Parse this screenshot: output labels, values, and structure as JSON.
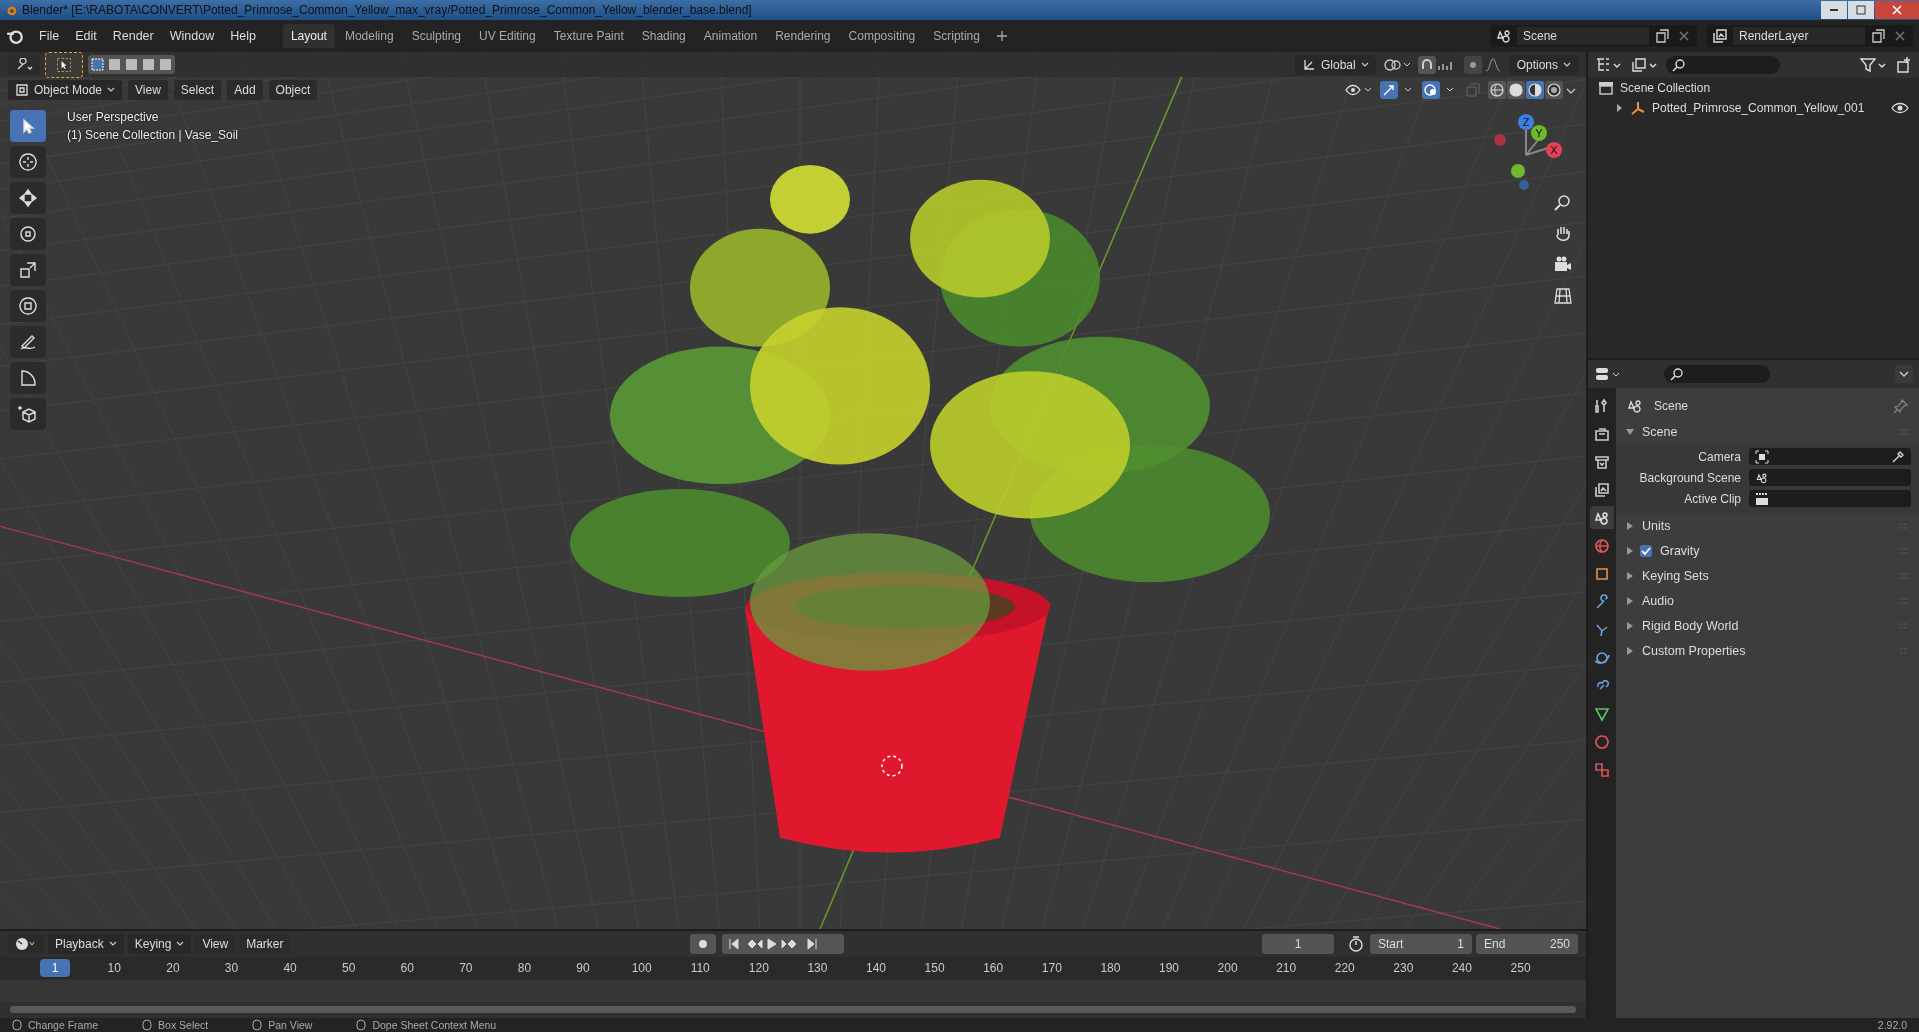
{
  "window": {
    "title": "Blender* [E:\\RABOTA\\CONVERT\\Potted_Primrose_Common_Yellow_max_vray/Potted_Primrose_Common_Yellow_blender_base.blend]"
  },
  "menu": [
    "File",
    "Edit",
    "Render",
    "Window",
    "Help"
  ],
  "workspaces": [
    {
      "label": "Layout",
      "selected": true
    },
    {
      "label": "Modeling",
      "selected": false
    },
    {
      "label": "Sculpting",
      "selected": false
    },
    {
      "label": "UV Editing",
      "selected": false
    },
    {
      "label": "Texture Paint",
      "selected": false
    },
    {
      "label": "Shading",
      "selected": false
    },
    {
      "label": "Animation",
      "selected": false
    },
    {
      "label": "Rendering",
      "selected": false
    },
    {
      "label": "Compositing",
      "selected": false
    },
    {
      "label": "Scripting",
      "selected": false
    }
  ],
  "scene_selector": {
    "value": "Scene"
  },
  "view_layer_selector": {
    "value": "RenderLayer"
  },
  "viewport": {
    "transform_orientation": "Global",
    "options": "Options",
    "mode": "Object Mode",
    "header_menu": [
      "View",
      "Select",
      "Add",
      "Object"
    ],
    "shading_modes": [
      {
        "kind": "wireframe",
        "selected": false
      },
      {
        "kind": "solid",
        "selected": false
      },
      {
        "kind": "material",
        "selected": true
      },
      {
        "kind": "rendered",
        "selected": false
      }
    ],
    "overlay_text": [
      "User Perspective",
      "(1) Scene Collection | Vase_Soil"
    ],
    "tools": [
      {
        "kind": "select",
        "selected": true
      },
      {
        "kind": "cursor",
        "selected": false
      },
      {
        "kind": "move",
        "selected": false
      },
      {
        "kind": "rotate",
        "selected": false
      },
      {
        "kind": "scale",
        "selected": false
      },
      {
        "kind": "transform",
        "selected": false
      },
      {
        "kind": "annotate",
        "selected": false
      },
      {
        "kind": "measure",
        "selected": false
      },
      {
        "kind": "add_cube",
        "selected": false
      }
    ],
    "gizmo_labels": [
      "Z",
      "Y",
      "X"
    ]
  },
  "outliner": {
    "root": "Scene Collection",
    "children": [
      {
        "label": "Potted_Primrose_Common_Yellow_001",
        "expanded": false,
        "visible": true
      }
    ]
  },
  "properties": {
    "tabs": [
      {
        "kind": "tool",
        "selected": false
      },
      {
        "kind": "render",
        "selected": false
      },
      {
        "kind": "output",
        "selected": false
      },
      {
        "kind": "view_layer",
        "selected": false
      },
      {
        "kind": "scene",
        "selected": true
      },
      {
        "kind": "world",
        "selected": false
      },
      {
        "kind": "object",
        "selected": false
      },
      {
        "kind": "modifier",
        "selected": false
      },
      {
        "kind": "particles",
        "selected": false
      },
      {
        "kind": "physics",
        "selected": false
      },
      {
        "kind": "constraints",
        "selected": false
      },
      {
        "kind": "data",
        "selected": false
      },
      {
        "kind": "material",
        "selected": false
      },
      {
        "kind": "texture",
        "selected": false
      }
    ],
    "context": "Scene",
    "panels": [
      {
        "title": "Scene",
        "expanded": true,
        "fields": [
          "Camera",
          "Background Scene",
          "Active Clip"
        ]
      },
      {
        "title": "Units",
        "expanded": false
      },
      {
        "title": "Gravity",
        "expanded": false,
        "checked": true
      },
      {
        "title": "Keying Sets",
        "expanded": false
      },
      {
        "title": "Audio",
        "expanded": false
      },
      {
        "title": "Rigid Body World",
        "expanded": false
      },
      {
        "title": "Custom Properties",
        "expanded": false
      }
    ]
  },
  "timeline": {
    "menu": [
      "Playback",
      "Keying",
      "View",
      "Marker"
    ],
    "current_frame": "1",
    "frame_field": "1",
    "start_label": "Start",
    "start": "1",
    "end_label": "End",
    "end": "250",
    "ticks": [
      "10",
      "20",
      "30",
      "40",
      "50",
      "60",
      "70",
      "80",
      "90",
      "100",
      "110",
      "120",
      "130",
      "140",
      "150",
      "160",
      "170",
      "180",
      "190",
      "200",
      "210",
      "220",
      "230",
      "240",
      "250"
    ]
  },
  "status_bar": {
    "hints": [
      "Change Frame",
      "Box Select",
      "Pan View",
      "Dope Sheet Context Menu"
    ],
    "version": "2.92.0"
  }
}
